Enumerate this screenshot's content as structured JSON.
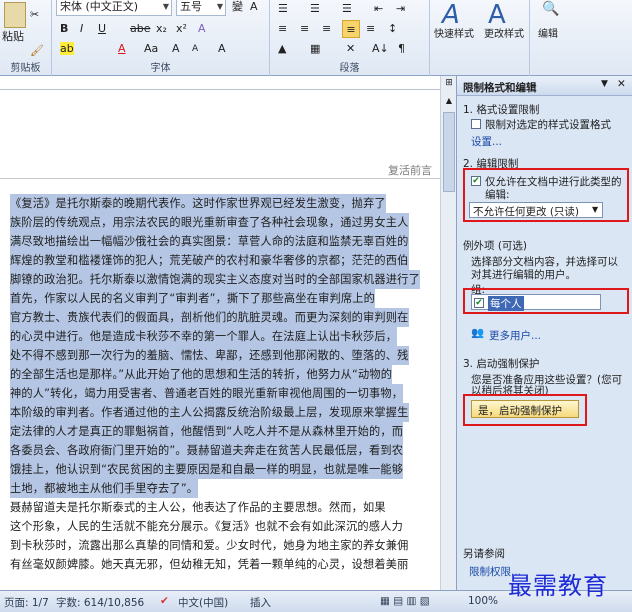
{
  "ribbon": {
    "clipboard": {
      "paste_label": "粘贴",
      "group_label": "剪贴板"
    },
    "font": {
      "font_name": "宋体 (中文正文)",
      "font_size": "五号",
      "bold": "B",
      "italic": "I",
      "underline": "U",
      "strike": "abe",
      "sub": "x₂",
      "sup": "x²",
      "font_color": "A",
      "grow": "A",
      "shrink": "A",
      "case": "Aa",
      "clear": "A",
      "group_label": "字体"
    },
    "paragraph": {
      "group_label": "段落"
    },
    "styles": {
      "quick_styles": "快速样式",
      "change_styles": "更改样式"
    },
    "edit": {
      "label": "编辑"
    }
  },
  "document": {
    "header_text": "复活前言",
    "lines": [
      {
        "text": "《复活》是托尔斯泰的晚期代表作。这时作家世界观已经发生激变，抛弃了",
        "sel": true
      },
      {
        "text": "族阶层的传统观点，用宗法农民的眼光重新审查了各种社会现象，通过男女主人",
        "sel": true
      },
      {
        "text": "满尽致地描绘出一幅幅沙俄社会的真实图景：草菅人命的法庭和监禁无辜百姓的",
        "sel": true
      },
      {
        "text": "辉煌的教堂和槛褛馑饰的犯人；荒芜破产的农村和豪华奢侈的京都；茫茫的西伯",
        "sel": true
      },
      {
        "text": "脚镣的政治犯。托尔斯泰以激情饱满的现实主义态度对当时的全部国家机器进行了",
        "sel": true
      },
      {
        "text": "    首先，作家以人民的名义审判了“审判者”，撕下了那些高坐在审判席上的",
        "sel": true
      },
      {
        "text": "官方教士、贵族代表们的假面具，剖析他们的肮脏灵魂。而更为深刻的审判则在",
        "sel": true
      },
      {
        "text": "的心灵中进行。他是造成卡秋莎不幸的第一个罪人。在法庭上认出卡秋莎后，",
        "sel": true
      },
      {
        "text": "处不得不感到那一次行为的羞脑、懦怯、卑鄙，还感到他那闲散的、堕落的、残",
        "sel": true
      },
      {
        "text": "的全部生活也是那样。”从此开始了他的思想和生活的转折，他努力从“动物的",
        "sel": true
      },
      {
        "text": "神的人”转化，竭力用受害者、普通老百姓的眼光重新审视他周围的一切事物，",
        "sel": true
      },
      {
        "text": "本阶级的审判者。作者通过他的主人公揭露反统治阶级最上层，发现原来掌握生",
        "sel": true
      },
      {
        "text": "定法律的人才是真正的罪魁祸首，他醒悟到“人吃人并不是从森林里开始的，而",
        "sel": true
      },
      {
        "text": "各委员会、各政府衙门里开始的”。聂赫留道夫奔走在贫苦人民最低层，看到农",
        "sel": true
      },
      {
        "text": "饿挂上，他认识到“农民贫困的主要原因是和自最一样的明显，也就是唯一能够",
        "sel": true
      },
      {
        "text": "土地，都被地主从他们手里夺去了”。",
        "sel": true
      },
      {
        "text": "    聂赫留道夫是托尔斯泰式的主人公，他表达了作品的主要思想。然而，如果",
        "sel": false
      },
      {
        "text": "这个形象，人民的生活就不能充分展示。《复活》也就不会有如此深沉的感人力",
        "sel": false
      },
      {
        "text": "到卡秋莎时，流露出那么真挚的同情和爱。少女时代，她身为地主家的养女兼佣",
        "sel": false
      },
      {
        "text": "有丝毫奴颜婢膝。她天真无邪，但幼稚无知，凭着一颗单纯的心灵，设想着美丽",
        "sel": false
      }
    ]
  },
  "pane": {
    "title": "限制格式和编辑",
    "sec1_title": "1. 格式设置限制",
    "sec1_checkbox": "限制对选定的样式设置格式",
    "sec1_link": "设置...",
    "sec2_title": "2. 编辑限制",
    "sec2_checkbox_l1": "仅允许在文档中进行此类型的",
    "sec2_checkbox_l2": "编辑:",
    "sec2_select": "不允许任何更改 (只读)",
    "exceptions_title": "例外项 (可选)",
    "exceptions_desc_l1": "选择部分文档内容，并选择可以",
    "exceptions_desc_l2": "对其进行编辑的用户。",
    "group_label": "组:",
    "everyone": "每个人",
    "more_users": "更多用户...",
    "sec3_title": "3. 启动强制保护",
    "sec3_q1": "您是否准备应用这些设置？(您可",
    "sec3_q2": "以稍后将其关闭)",
    "start_button": "是，启动强制保护",
    "see_also": "另请参阅",
    "restrict_perm": "限制权限..."
  },
  "status": {
    "page": "页面: 1/7",
    "words": "字数: 614/10,856",
    "language": "中文(中国)",
    "insert": "插入",
    "zoom": "100%"
  },
  "watermark": "最需教育"
}
